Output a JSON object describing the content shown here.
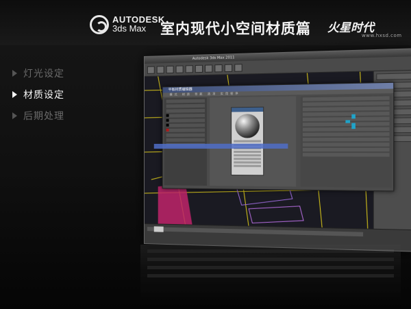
{
  "header": {
    "brand_line1": "AUTODESK",
    "brand_line2": "3ds Max",
    "title": "室内现代小空间材质篇",
    "site_logo": "火星时代",
    "site_url": "www.hxsd.com"
  },
  "menu": {
    "items": [
      {
        "label": "灯光设定",
        "active": false
      },
      {
        "label": "材质设定",
        "active": true
      },
      {
        "label": "后期处理",
        "active": false
      }
    ]
  },
  "app": {
    "window_title": "Autodesk 3ds Max 2011",
    "material_editor": {
      "title": "平板材质编辑器",
      "menu": "模式 材质 导航 选项 实用程序"
    }
  },
  "colors": {
    "background": "#121212",
    "menu_active": "#f4f4f4",
    "menu_inactive": "#6a6a6a",
    "viewport_wire": "#d4c21a",
    "accent_cyan": "#1fa3c9",
    "accent_blue": "#506ec8"
  }
}
